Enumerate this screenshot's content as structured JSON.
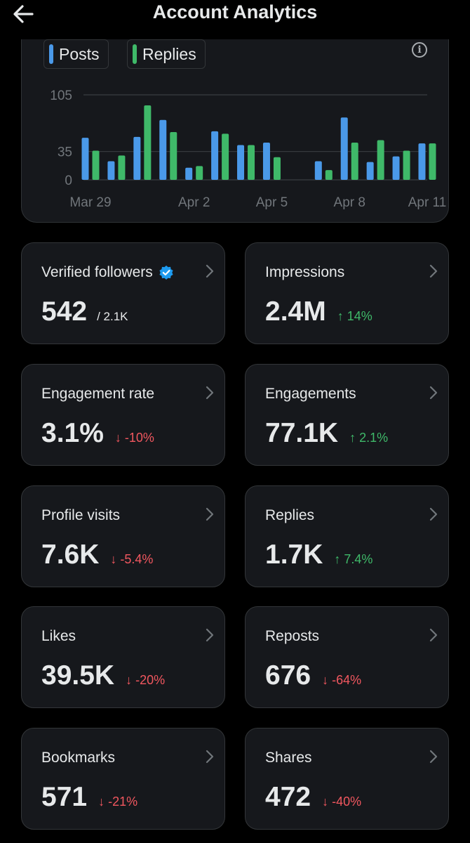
{
  "header": {
    "title": "Account Analytics",
    "back_icon": "arrow-left-icon"
  },
  "legend": {
    "posts": {
      "label": "Posts",
      "color": "#4a99e9"
    },
    "replies": {
      "label": "Replies",
      "color": "#3fb969"
    }
  },
  "chart_data": {
    "type": "bar",
    "x_ticks": [
      "Mar 29",
      "Apr 2",
      "Apr 5",
      "Apr 8",
      "Apr 11"
    ],
    "y_ticks": [
      0,
      35,
      105
    ],
    "ylim": [
      0,
      105
    ],
    "categories": [
      "Mar 29",
      "Mar 30",
      "Mar 31",
      "Apr 1",
      "Apr 2",
      "Apr 3",
      "Apr 4",
      "Apr 5",
      "Apr 6",
      "Apr 7",
      "Apr 8",
      "Apr 9",
      "Apr 10",
      "Apr 11"
    ],
    "series": [
      {
        "name": "Posts",
        "color": "#4a99e9",
        "values": [
          52,
          23,
          53,
          74,
          15,
          60,
          43,
          46,
          null,
          23,
          77,
          22,
          29,
          45
        ]
      },
      {
        "name": "Replies",
        "color": "#3fb969",
        "values": [
          36,
          30,
          92,
          59,
          17,
          57,
          43,
          28,
          null,
          12,
          46,
          49,
          36,
          45
        ]
      }
    ]
  },
  "cards": [
    {
      "label": "Verified followers",
      "value": "542",
      "sub": "/ 2.1K",
      "verified": true
    },
    {
      "label": "Impressions",
      "value": "2.4M",
      "delta": "↑ 14%",
      "dir": "up"
    },
    {
      "label": "Engagement rate",
      "value": "3.1%",
      "delta": "↓ -10%",
      "dir": "down"
    },
    {
      "label": "Engagements",
      "value": "77.1K",
      "delta": "↑ 2.1%",
      "dir": "up"
    },
    {
      "label": "Profile visits",
      "value": "7.6K",
      "delta": "↓ -5.4%",
      "dir": "down"
    },
    {
      "label": "Replies",
      "value": "1.7K",
      "delta": "↑ 7.4%",
      "dir": "up"
    },
    {
      "label": "Likes",
      "value": "39.5K",
      "delta": "↓ -20%",
      "dir": "down"
    },
    {
      "label": "Reposts",
      "value": "676",
      "delta": "↓ -64%",
      "dir": "down"
    },
    {
      "label": "Bookmarks",
      "value": "571",
      "delta": "↓ -21%",
      "dir": "down"
    },
    {
      "label": "Shares",
      "value": "472",
      "delta": "↓ -40%",
      "dir": "down"
    }
  ]
}
